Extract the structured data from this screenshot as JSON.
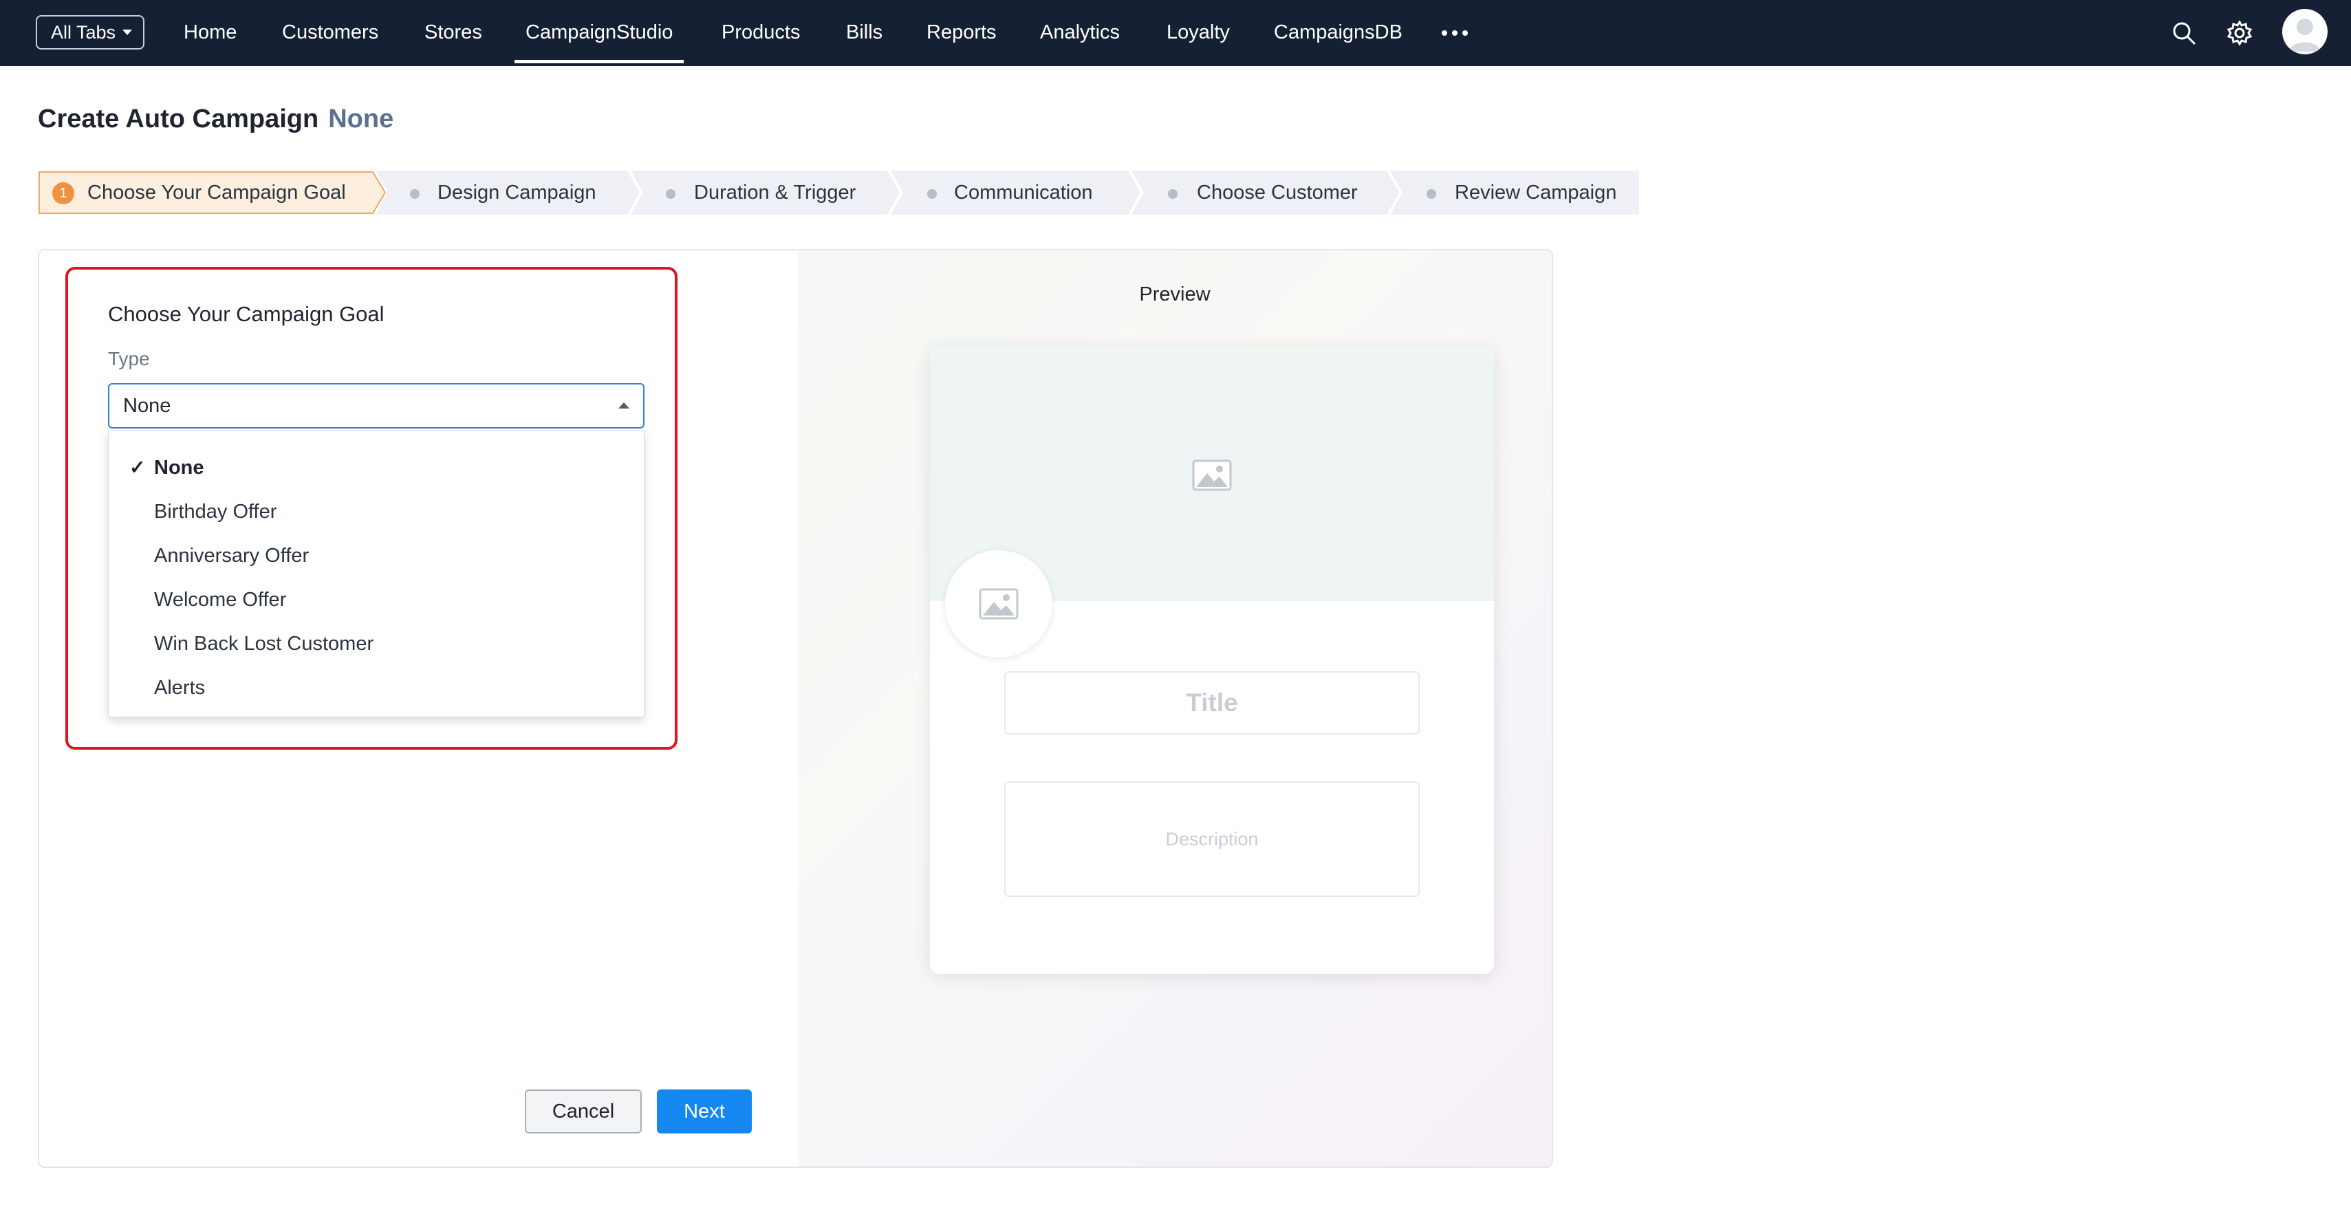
{
  "nav": {
    "all_tabs": "All Tabs",
    "items": [
      "Home",
      "Customers",
      "Stores",
      "CampaignStudio",
      "Products",
      "Bills",
      "Reports",
      "Analytics",
      "Loyalty",
      "CampaignsDB"
    ],
    "active": "CampaignStudio",
    "icons": [
      "more-icon",
      "search-icon",
      "gear-icon",
      "avatar"
    ]
  },
  "page": {
    "title": "Create Auto Campaign",
    "campaign_name": "None"
  },
  "steps": [
    {
      "number": "1",
      "label": "Choose Your Campaign Goal",
      "state": "current"
    },
    {
      "label": "Design Campaign",
      "state": "pending"
    },
    {
      "label": "Duration & Trigger",
      "state": "pending"
    },
    {
      "label": "Communication",
      "state": "pending"
    },
    {
      "label": "Choose Customer",
      "state": "pending"
    },
    {
      "label": "Review Campaign",
      "state": "pending"
    }
  ],
  "goal": {
    "title": "Choose Your Campaign Goal",
    "type_label": "Type",
    "selected": "None",
    "options": [
      "None",
      "Birthday Offer",
      "Anniversary Offer",
      "Welcome Offer",
      "Win Back Lost Customer",
      "Alerts"
    ]
  },
  "actions": {
    "cancel": "Cancel",
    "next": "Next"
  },
  "preview": {
    "label": "Preview",
    "title_placeholder": "Title",
    "description_placeholder": "Description"
  },
  "colors": {
    "nav_bg": "#152034",
    "accent_blue": "#1488f0",
    "step_active": "#f2913d",
    "highlight_border": "#e0141e"
  }
}
